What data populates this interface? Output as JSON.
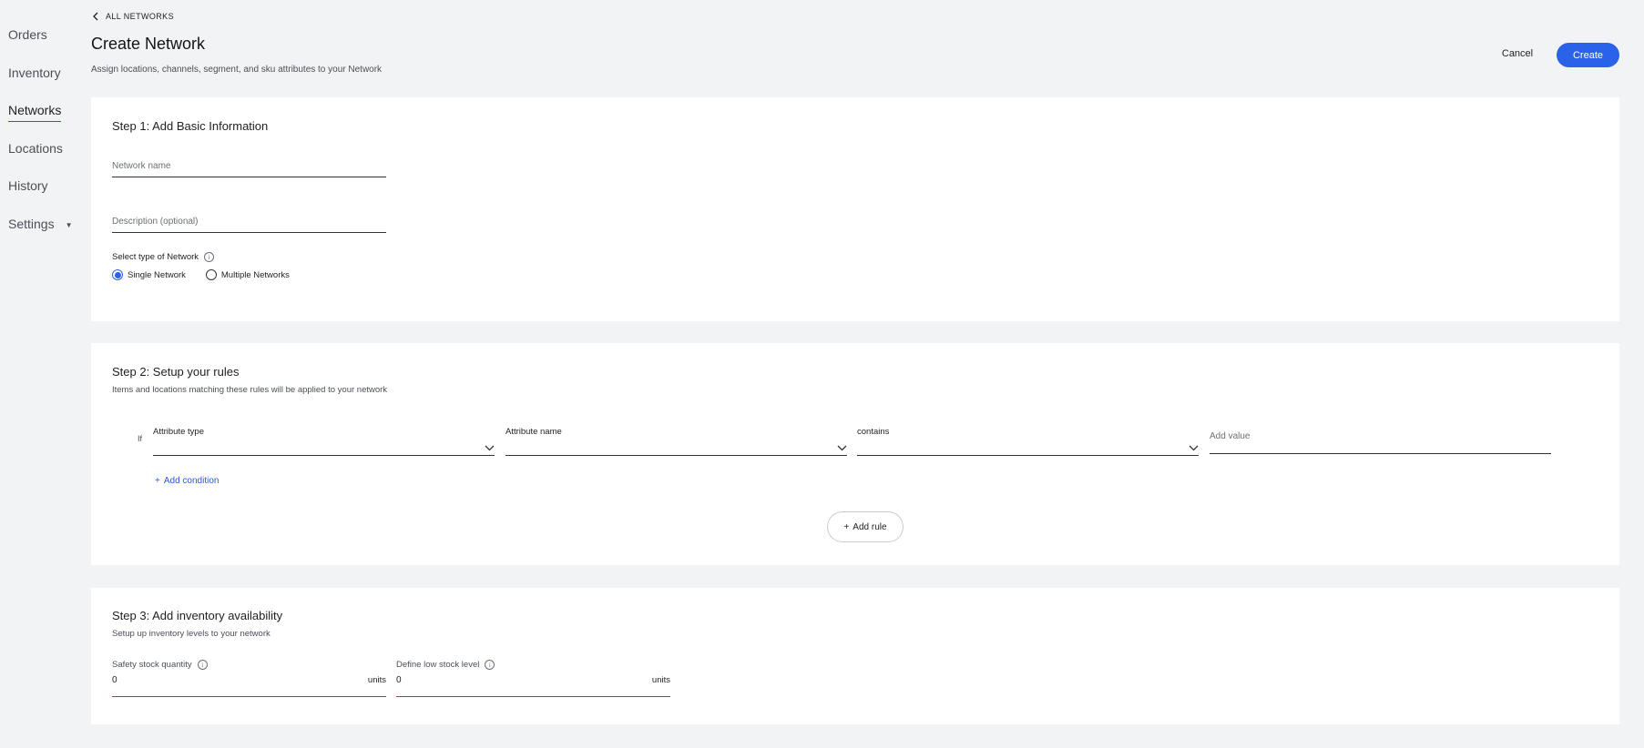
{
  "sidebar": {
    "items": [
      {
        "label": "Orders"
      },
      {
        "label": "Inventory"
      },
      {
        "label": "Networks"
      },
      {
        "label": "Locations"
      },
      {
        "label": "History"
      },
      {
        "label": "Settings"
      }
    ]
  },
  "header": {
    "back_label": "ALL NETWORKS",
    "title": "Create Network",
    "subtitle": "Assign locations, channels, segment, and sku attributes to your Network",
    "cancel_label": "Cancel",
    "create_label": "Create"
  },
  "step1": {
    "title": "Step 1: Add Basic Information",
    "network_name_placeholder": "Network name",
    "description_placeholder": "Description (optional)",
    "type_label": "Select type of Network",
    "options": [
      {
        "label": "Single Network",
        "selected": true
      },
      {
        "label": "Multiple Networks",
        "selected": false
      }
    ]
  },
  "step2": {
    "title": "Step 2: Setup your rules",
    "subtitle": "Items and locations matching these rules will be applied to your network",
    "if_label": "If",
    "attribute_type_label": "Attribute type",
    "attribute_name_label": "Attribute name",
    "operator_label": "contains",
    "value_placeholder": "Add value",
    "add_condition_label": "Add condition",
    "add_rule_label": "Add rule"
  },
  "step3": {
    "title": "Step 3: Add inventory availability",
    "subtitle": "Setup up inventory levels to your network",
    "safety_label": "Safety stock quantity",
    "safety_value": "0",
    "low_label": "Define low stock level",
    "low_value": "0",
    "unit": "units"
  },
  "colors": {
    "accent": "#2a62e8",
    "background": "#f2f3f5",
    "card": "#ffffff"
  }
}
